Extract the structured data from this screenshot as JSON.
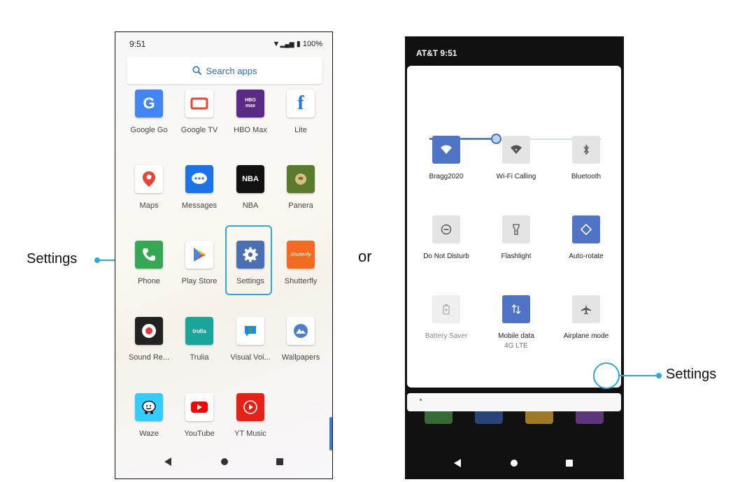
{
  "left_phone": {
    "status_time": "9:51",
    "status_battery": "100%",
    "search_placeholder": "Search apps",
    "apps": [
      {
        "id": "google-go",
        "label": "Google Go",
        "color": "#4285f4",
        "row": 0,
        "col": 0
      },
      {
        "id": "google-tv",
        "label": "Google TV",
        "color": "#ffffff",
        "row": 0,
        "col": 1
      },
      {
        "id": "hbo-max",
        "label": "HBO Max",
        "color": "#5b2a86",
        "row": 0,
        "col": 2
      },
      {
        "id": "lite",
        "label": "Lite",
        "color": "#ffffff",
        "row": 0,
        "col": 3
      },
      {
        "id": "maps",
        "label": "Maps",
        "color": "#ffffff",
        "row": 1,
        "col": 0
      },
      {
        "id": "messages",
        "label": "Messages",
        "color": "#1a73e8",
        "row": 1,
        "col": 1
      },
      {
        "id": "nba",
        "label": "NBA",
        "color": "#111111",
        "row": 1,
        "col": 2
      },
      {
        "id": "panera",
        "label": "Panera",
        "color": "#5a7a2e",
        "row": 1,
        "col": 3
      },
      {
        "id": "phone",
        "label": "Phone",
        "color": "#34a853",
        "row": 2,
        "col": 0
      },
      {
        "id": "play-store",
        "label": "Play Store",
        "color": "#ffffff",
        "row": 2,
        "col": 1
      },
      {
        "id": "settings",
        "label": "Settings",
        "color": "#4a6fb3",
        "row": 2,
        "col": 2
      },
      {
        "id": "shutterfly",
        "label": "Shutterfly",
        "color": "#f26b21",
        "row": 2,
        "col": 3
      },
      {
        "id": "sound-recorder",
        "label": "Sound Re...",
        "color": "#222222",
        "row": 3,
        "col": 0
      },
      {
        "id": "trulia",
        "label": "Trulia",
        "color": "#19a59a",
        "row": 3,
        "col": 1
      },
      {
        "id": "visual-voicemail",
        "label": "Visual Voi...",
        "color": "#ffffff",
        "row": 3,
        "col": 2
      },
      {
        "id": "wallpapers",
        "label": "Wallpapers",
        "color": "#ffffff",
        "row": 3,
        "col": 3
      },
      {
        "id": "waze",
        "label": "Waze",
        "color": "#33ccff",
        "row": 4,
        "col": 0
      },
      {
        "id": "youtube",
        "label": "YouTube",
        "color": "#ffffff",
        "row": 4,
        "col": 1
      },
      {
        "id": "yt-music",
        "label": "YT Music",
        "color": "#e62117",
        "row": 4,
        "col": 2
      }
    ],
    "app_glyphs": {
      "google-go": "G",
      "hbo-max": "HBO\nmax",
      "lite": "f",
      "nba": "NBA",
      "shutterfly": "Shutterfly",
      "trulia": "trulia"
    }
  },
  "callout_left": {
    "label": "Settings"
  },
  "separator": {
    "label": "or"
  },
  "right_phone": {
    "status": "AT&T  9:51",
    "brightness_fraction": 0.39,
    "tiles": [
      {
        "id": "wifi",
        "label": "Bragg2020",
        "sub": "",
        "state": "on",
        "icon": "wifi-icon"
      },
      {
        "id": "wifi-calling",
        "label": "Wi-Fi Calling",
        "sub": "",
        "state": "off",
        "icon": "wifi-calling-icon"
      },
      {
        "id": "bluetooth",
        "label": "Bluetooth",
        "sub": "",
        "state": "off",
        "icon": "bluetooth-icon"
      },
      {
        "id": "dnd",
        "label": "Do Not Disturb",
        "sub": "",
        "state": "off",
        "icon": "do-not-disturb-icon"
      },
      {
        "id": "flashlight",
        "label": "Flashlight",
        "sub": "",
        "state": "off",
        "icon": "flashlight-icon"
      },
      {
        "id": "auto-rotate",
        "label": "Auto-rotate",
        "sub": "",
        "state": "on",
        "icon": "auto-rotate-icon"
      },
      {
        "id": "battery-saver",
        "label": "Battery Saver",
        "sub": "",
        "state": "dim",
        "icon": "battery-saver-icon"
      },
      {
        "id": "mobile-data",
        "label": "Mobile data",
        "sub": "4G LTE",
        "state": "on",
        "icon": "mobile-data-icon"
      },
      {
        "id": "airplane",
        "label": "Airplane mode",
        "sub": "",
        "state": "off",
        "icon": "airplane-icon"
      }
    ]
  },
  "callout_right": {
    "label": "Settings"
  },
  "colors": {
    "accent": "#29a9e1",
    "tile_on": "#4f74c6",
    "search_text": "#2c6bd4"
  }
}
